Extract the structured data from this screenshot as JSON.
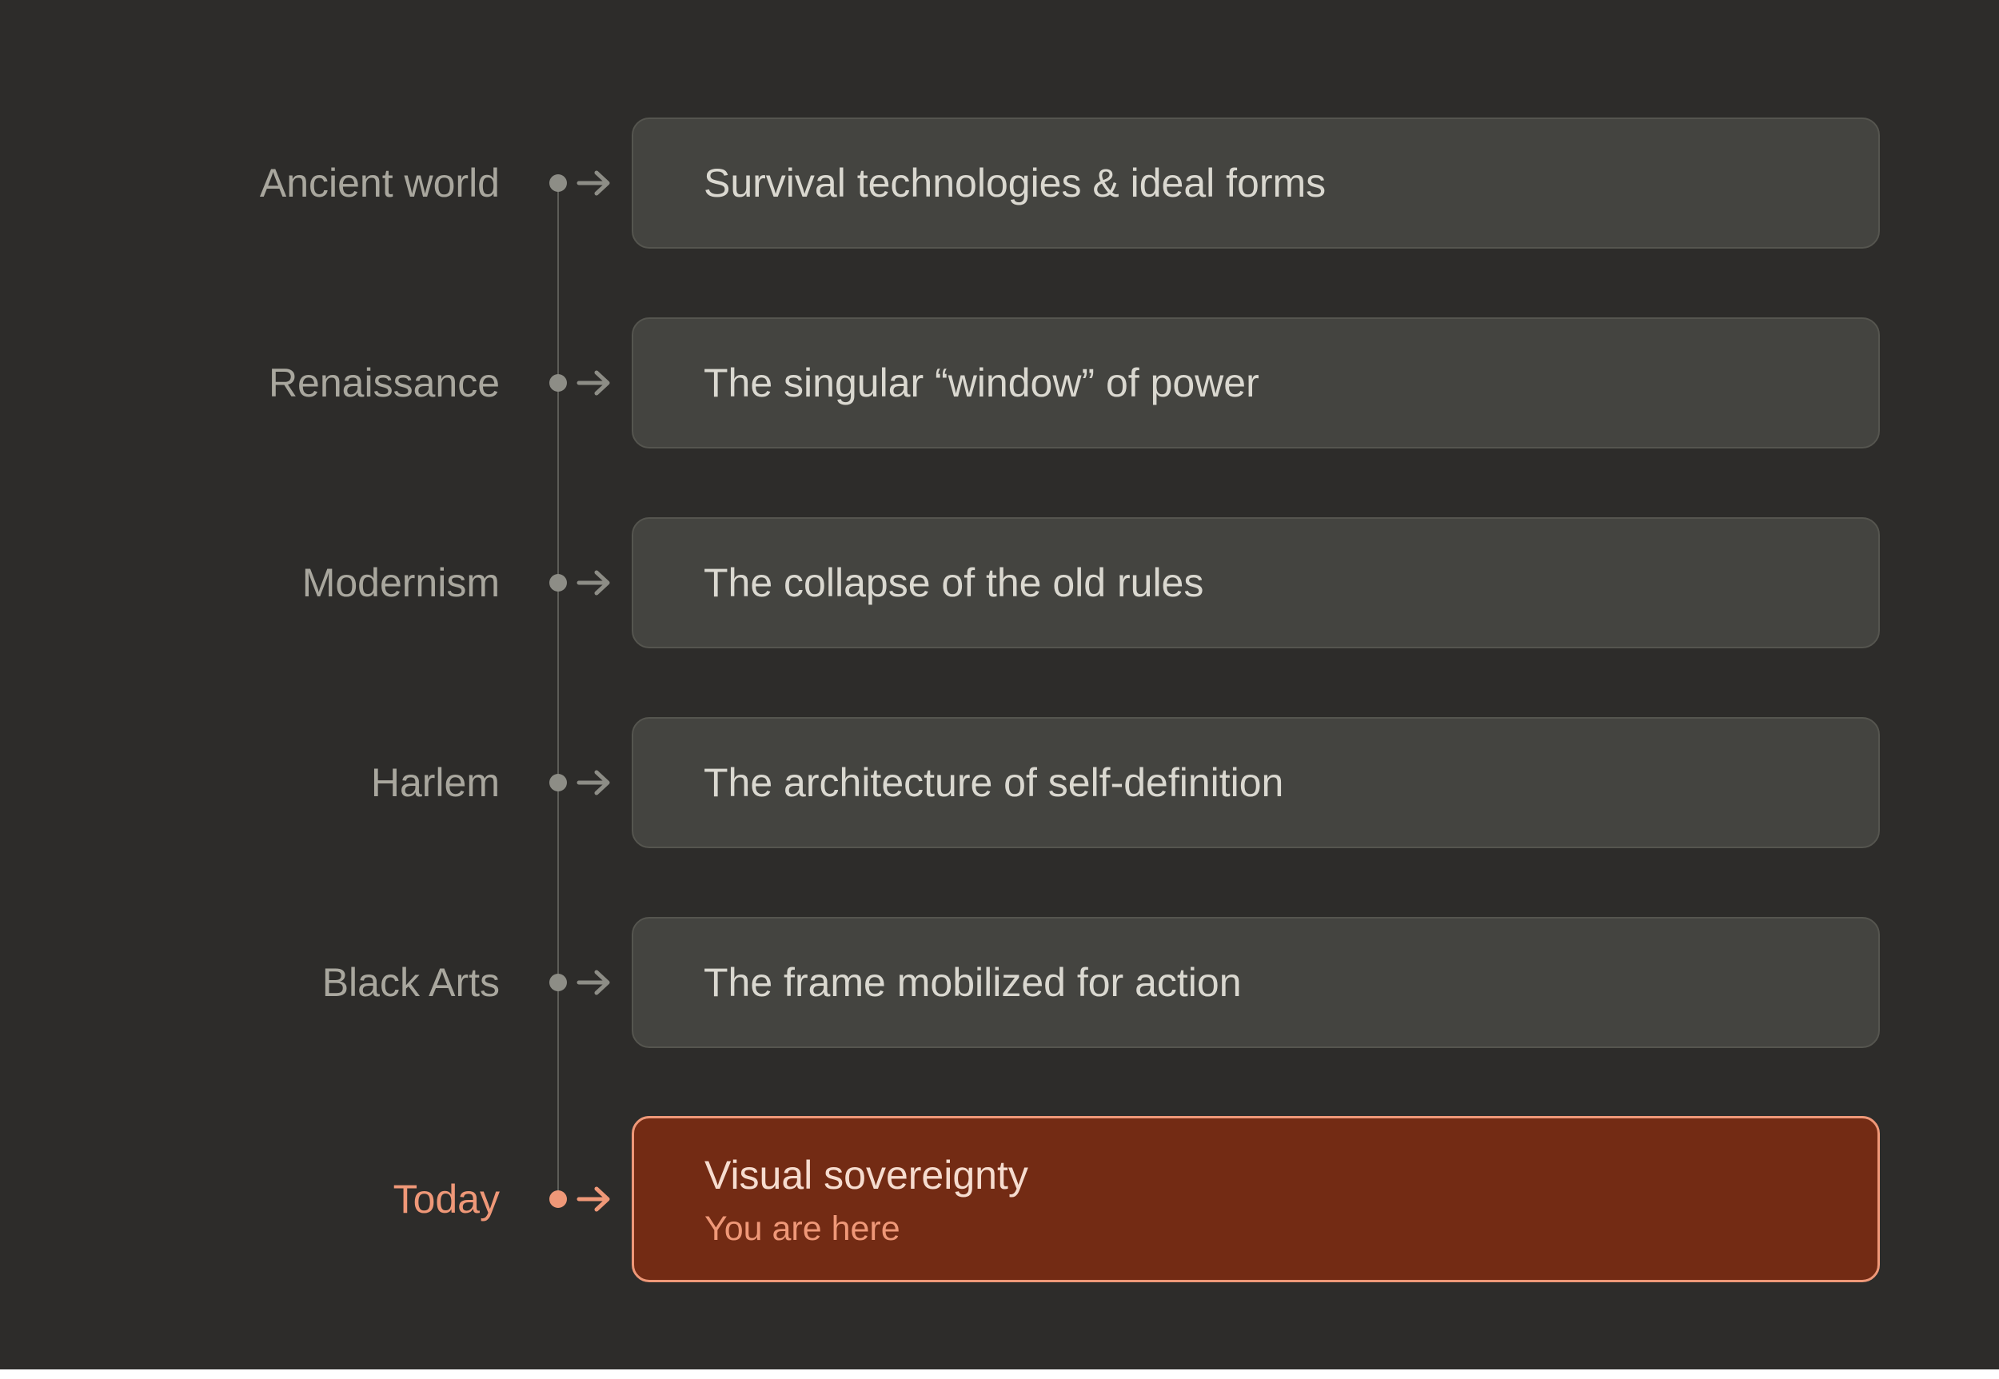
{
  "colors": {
    "background": "#2d2c2a",
    "box_fill": "#444440",
    "box_border": "#55554f",
    "label_text": "#a9a79e",
    "box_text": "#dad8d0",
    "connector": "#8d8d86",
    "accent": "#ef9878",
    "active_fill": "#732b14"
  },
  "timeline": {
    "eras": [
      {
        "label": "Ancient world",
        "description": "Survival technologies & ideal forms"
      },
      {
        "label": "Renaissance",
        "description": "The singular “window” of power"
      },
      {
        "label": "Modernism",
        "description": "The collapse of the old rules"
      },
      {
        "label": "Harlem",
        "description": "The architecture of self-definition"
      },
      {
        "label": "Black Arts",
        "description": "The frame mobilized for action"
      }
    ],
    "current": {
      "label": "Today",
      "description": "Visual sovereignty",
      "note": "You are here"
    }
  }
}
